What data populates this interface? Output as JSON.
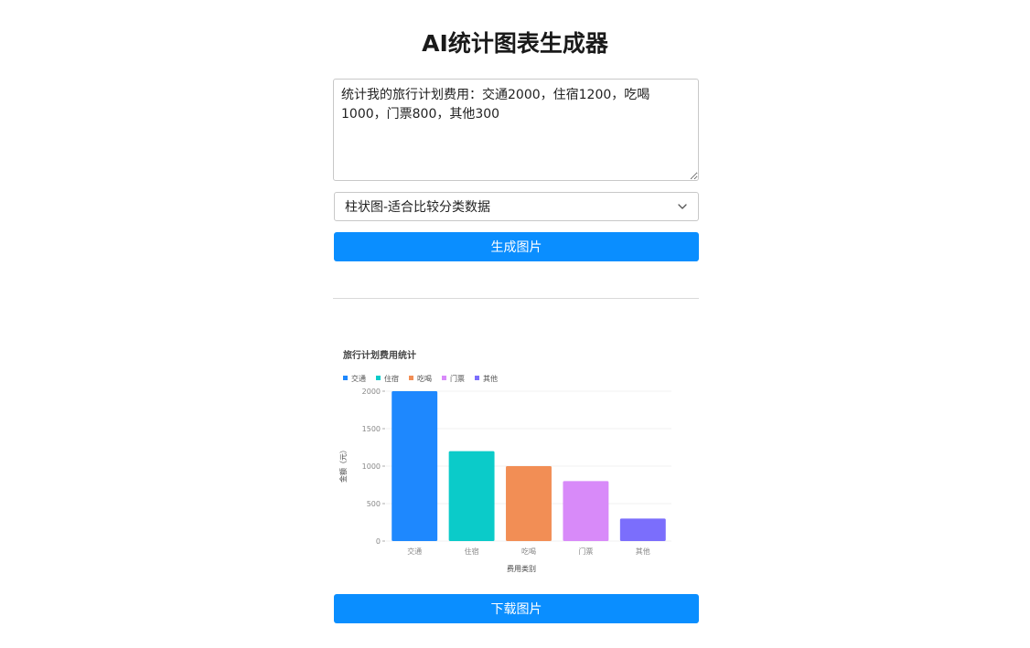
{
  "page": {
    "title": "AI统计图表生成器"
  },
  "form": {
    "prompt_value": "统计我的旅行计划费用：交通2000，住宿1200，吃喝1000，门票800，其他300",
    "chart_type_selected": "柱状图-适合比较分类数据",
    "generate_label": "生成图片",
    "download_label": "下载图片"
  },
  "icons": {
    "select_arrow": "chevron-down-icon"
  },
  "chart_data": {
    "type": "bar",
    "title": "旅行计划费用统计",
    "xlabel": "费用类别",
    "ylabel": "金额（元）",
    "categories": [
      "交通",
      "住宿",
      "吃喝",
      "门票",
      "其他"
    ],
    "values": [
      2000,
      1200,
      1000,
      800,
      300
    ],
    "colors": [
      "#1e88fe",
      "#0bcbc9",
      "#f28e55",
      "#d88af9",
      "#7b6efc"
    ],
    "ylim": [
      0,
      2000
    ],
    "yticks": [
      0,
      500,
      1000,
      1500,
      2000
    ],
    "legend": [
      "交通",
      "住宿",
      "吃喝",
      "门票",
      "其他"
    ],
    "legend_position": "top-left",
    "grid": true
  }
}
